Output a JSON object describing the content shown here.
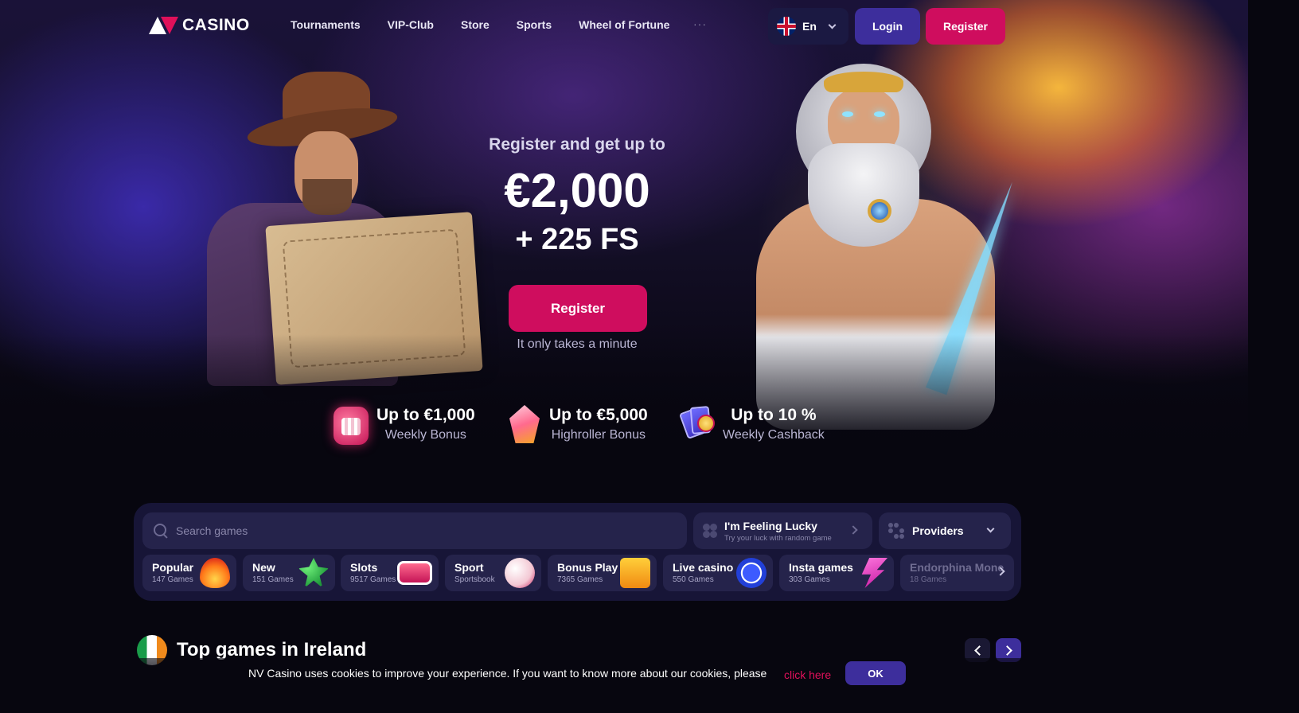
{
  "header": {
    "logo_text": "CASINO",
    "nav": [
      "Tournaments",
      "VIP-Club",
      "Store",
      "Sports",
      "Wheel of Fortune"
    ],
    "more": "···",
    "language": "En",
    "login_label": "Login",
    "register_label": "Register"
  },
  "hero": {
    "subtitle": "Register and get up to",
    "amount": "€2,000",
    "free_spins": "+ 225 FS",
    "register_label": "Register",
    "note": "It only takes a minute"
  },
  "promos": [
    {
      "title": "Up to €1,000",
      "subtitle": "Weekly Bonus",
      "icon": "calendar-icon"
    },
    {
      "title": "Up to €5,000",
      "subtitle": "Highroller Bonus",
      "icon": "gem-icon"
    },
    {
      "title": "Up to 10 %",
      "subtitle": "Weekly Cashback",
      "icon": "cards-icon"
    }
  ],
  "games_panel": {
    "search_placeholder": "Search games",
    "lucky_title": "I'm Feeling Lucky",
    "lucky_subtitle": "Try your luck with random game",
    "providers_label": "Providers",
    "categories": [
      {
        "name": "Popular",
        "count": "147 Games",
        "icon": "fire-icon"
      },
      {
        "name": "New",
        "count": "151 Games",
        "icon": "clover-icon"
      },
      {
        "name": "Slots",
        "count": "9517 Games",
        "icon": "slot-machine-icon"
      },
      {
        "name": "Sport",
        "count": "Sportsbook",
        "icon": "soccer-ball-icon"
      },
      {
        "name": "Bonus Play",
        "count": "7365 Games",
        "icon": "gift-icon"
      },
      {
        "name": "Live casino",
        "count": "550 Games",
        "icon": "poker-chip-icon"
      },
      {
        "name": "Insta games",
        "count": "303 Games",
        "icon": "lightning-icon"
      },
      {
        "name": "Endorphina Mone",
        "count": "18 Games",
        "icon": ""
      }
    ]
  },
  "top_games": {
    "title": "Top games in Ireland"
  },
  "cookie": {
    "text": "NV Casino uses cookies to improve your experience. If you want to know more about our cookies, please",
    "link": "click here",
    "ok_label": "OK"
  },
  "colors": {
    "accent_pink": "#cf0d5e",
    "accent_purple": "#3d2e9c",
    "panel_bg": "#171537",
    "chip_bg": "#25234b"
  }
}
